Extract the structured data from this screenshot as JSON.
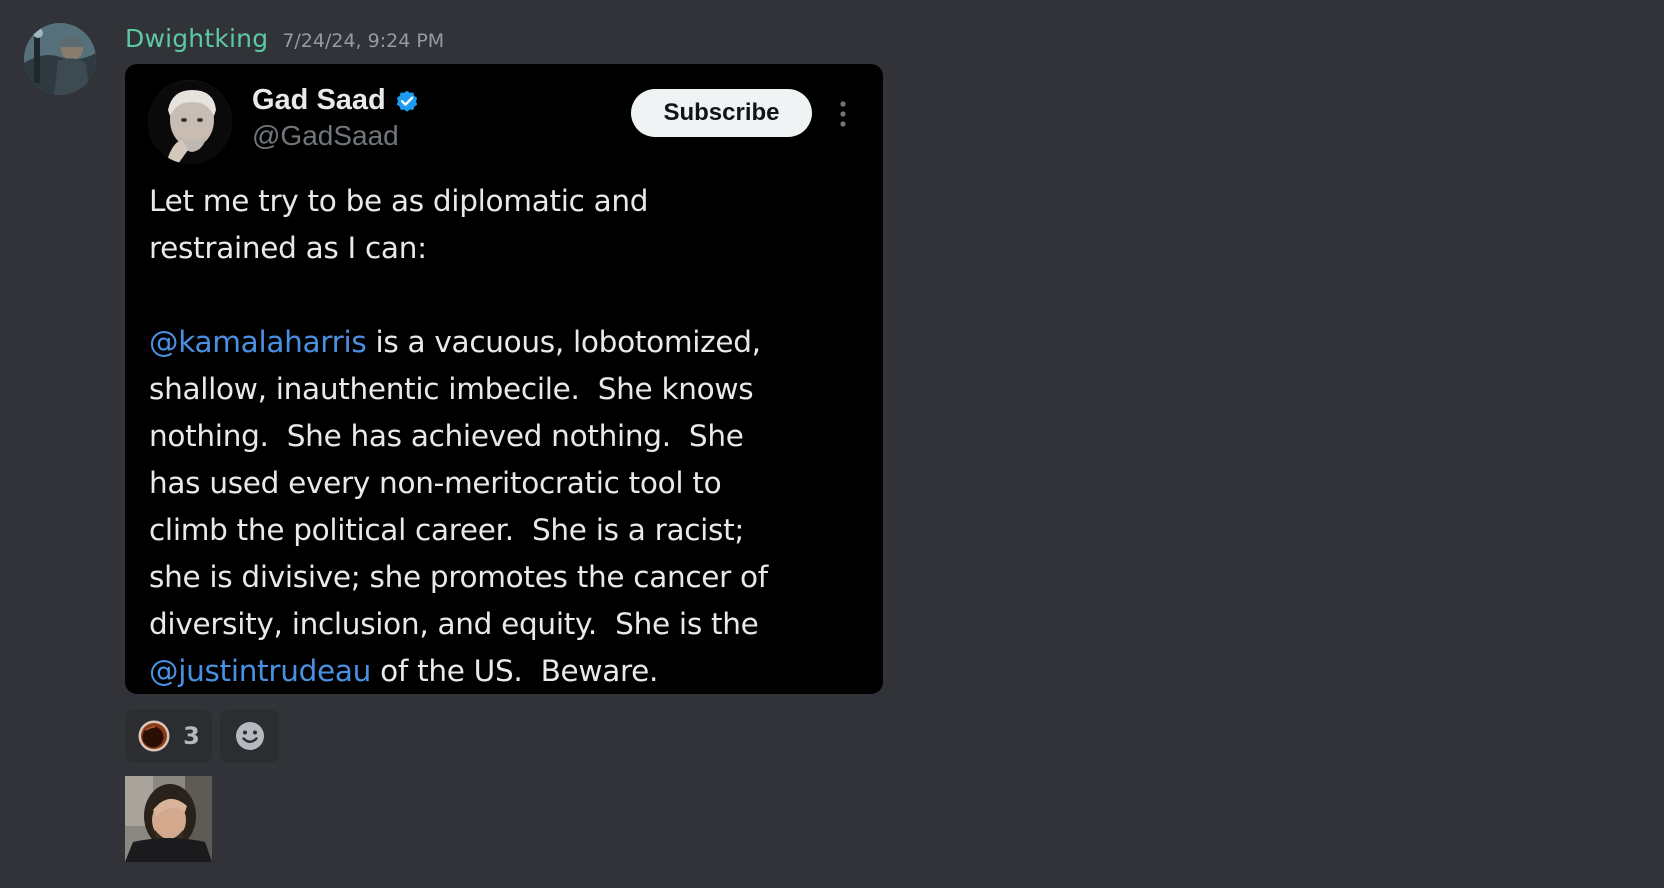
{
  "message": {
    "author": "Dwightking",
    "timestamp": "7/24/24, 9:24 PM"
  },
  "embed": {
    "name": "Gad Saad",
    "handle": "@GadSaad",
    "subscribe_label": "Subscribe",
    "lines": [
      [
        {
          "t": "Let me try to be as diplomatic and"
        }
      ],
      [
        {
          "t": "restrained as I can:"
        }
      ],
      [
        {
          "t": ""
        }
      ],
      [
        {
          "t": "@kamalaharris",
          "m": true
        },
        {
          "t": " is a vacuous, lobotomized,"
        }
      ],
      [
        {
          "t": "shallow, inauthentic imbecile.  She knows"
        }
      ],
      [
        {
          "t": "nothing.  She has achieved nothing.  She"
        }
      ],
      [
        {
          "t": "has used every non-meritocratic tool to"
        }
      ],
      [
        {
          "t": "climb the political career.  She is a racist;"
        }
      ],
      [
        {
          "t": "she is divisive; she promotes the cancer of"
        }
      ],
      [
        {
          "t": "diversity, inclusion, and equity.  She is the"
        }
      ],
      [
        {
          "t": "@justintrudeau",
          "m": true
        },
        {
          "t": " of the US.  Beware."
        }
      ]
    ]
  },
  "reactions": [
    {
      "emoji": "coffee-cup-icon",
      "count": "3"
    }
  ],
  "colors": {
    "background": "#313338",
    "username": "#5dc9a0",
    "mention": "#4a90e2",
    "verified": "#1d9bf0"
  }
}
